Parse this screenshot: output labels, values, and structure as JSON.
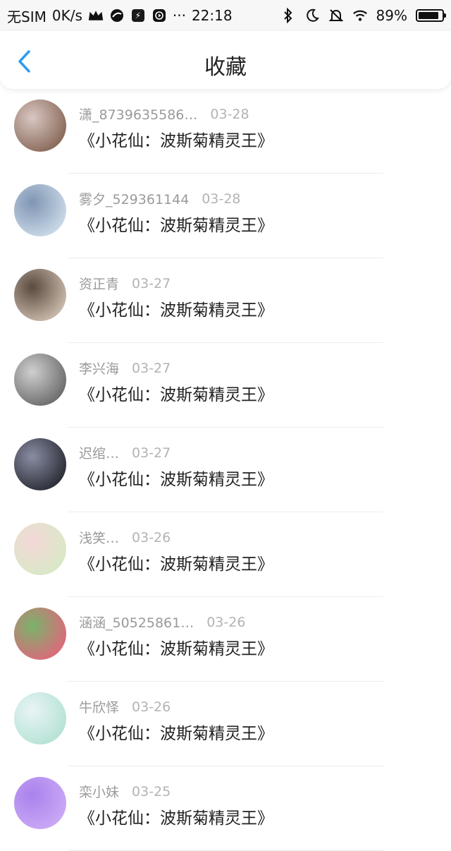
{
  "status_bar": {
    "carrier": "无SIM",
    "speed": "0K/s",
    "dots": "···",
    "time": "22:18",
    "battery_percent": "89%",
    "battery_level": 0.89
  },
  "nav": {
    "title": "收藏",
    "back_icon": "chevron-left-icon",
    "accent_color": "#2f9bf0"
  },
  "items": [
    {
      "name": "潇_8739635586…",
      "date": "03-28",
      "title": "《小花仙：波斯菊精灵王》",
      "avatar_colors": [
        "#8b6c5c",
        "#d9c7c2"
      ]
    },
    {
      "name": "雾夕_529361144",
      "date": "03-28",
      "title": "《小花仙：波斯菊精灵王》",
      "avatar_colors": [
        "#c8d7e6",
        "#7f95b3"
      ]
    },
    {
      "name": "资正青",
      "date": "03-27",
      "title": "《小花仙：波斯菊精灵王》",
      "avatar_colors": [
        "#c7b7a8",
        "#5a4a3f"
      ]
    },
    {
      "name": "李兴海",
      "date": "03-27",
      "title": "《小花仙：波斯菊精灵王》",
      "avatar_colors": [
        "#6f6f6f",
        "#cfcfcf"
      ]
    },
    {
      "name": "迟绾…",
      "date": "03-27",
      "title": "《小花仙：波斯菊精灵王》",
      "avatar_colors": [
        "#2d2f39",
        "#8a8ea3"
      ]
    },
    {
      "name": "浅笑…",
      "date": "03-26",
      "title": "《小花仙：波斯菊精灵王》",
      "avatar_colors": [
        "#d9e8c7",
        "#f4d7d7"
      ]
    },
    {
      "name": "涵涵_50525861…",
      "date": "03-26",
      "title": "《小花仙：波斯菊精灵王》",
      "avatar_colors": [
        "#d96c7a",
        "#7ab36b"
      ]
    },
    {
      "name": "牛欣怿",
      "date": "03-26",
      "title": "《小花仙：波斯菊精灵王》",
      "avatar_colors": [
        "#b7e3d6",
        "#e8f4f6"
      ]
    },
    {
      "name": "栾小妹",
      "date": "03-25",
      "title": "《小花仙：波斯菊精灵王》",
      "avatar_colors": [
        "#c9a7f5",
        "#a982ec"
      ]
    }
  ]
}
